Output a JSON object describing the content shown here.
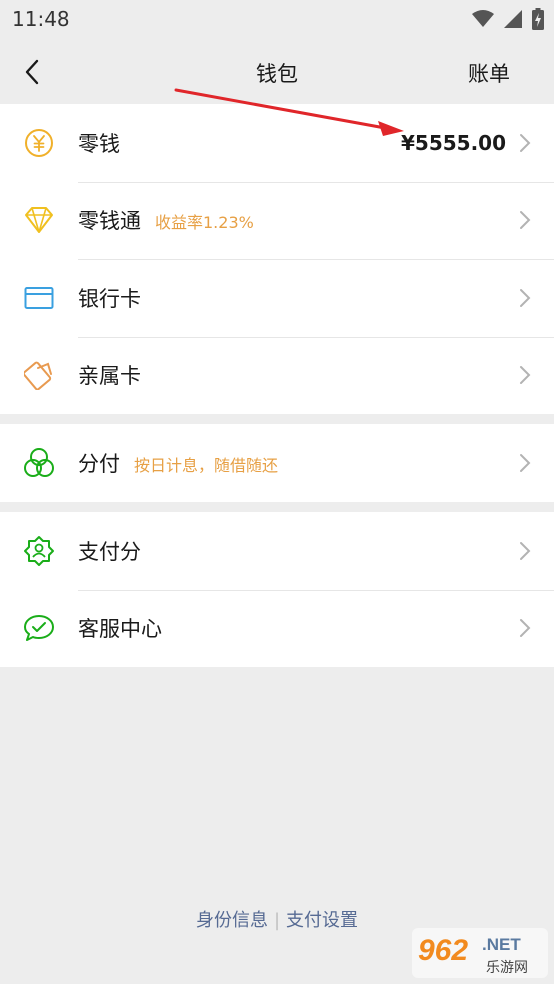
{
  "status_bar": {
    "time": "11:48"
  },
  "nav": {
    "title": "钱包",
    "right_label": "账单"
  },
  "groups": [
    {
      "items": [
        {
          "label": "零钱",
          "value": "¥5555.00"
        },
        {
          "label": "零钱通",
          "sub": "收益率1.23%"
        },
        {
          "label": "银行卡"
        },
        {
          "label": "亲属卡"
        }
      ]
    },
    {
      "items": [
        {
          "label": "分付",
          "sub": "按日计息，随借随还"
        }
      ]
    },
    {
      "items": [
        {
          "label": "支付分"
        },
        {
          "label": "客服中心"
        }
      ]
    }
  ],
  "footer": {
    "identity": "身份信息",
    "separator": "|",
    "pay_settings": "支付设置"
  },
  "watermark": {
    "brand": "962",
    "suffix": ".NET",
    "sub": "乐游网"
  },
  "colors": {
    "accent_orange": "#e7a045",
    "accent_green": "#1aad19",
    "link_blue": "#566a93",
    "annotation_red": "#e0262a"
  }
}
